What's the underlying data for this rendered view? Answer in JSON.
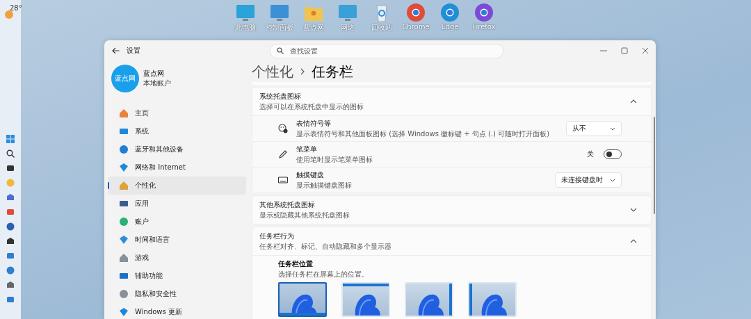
{
  "taskbar": {
    "weather": "28°"
  },
  "desktop_icons": [
    {
      "label": "此电脑"
    },
    {
      "label": "控制面板"
    },
    {
      "label": "蓝点网"
    },
    {
      "label": "网络"
    },
    {
      "label": "回收站"
    },
    {
      "label": "Chrome"
    },
    {
      "label": "Edge"
    },
    {
      "label": "Firefox"
    }
  ],
  "window": {
    "title": "设置",
    "search": {
      "placeholder": "查找设置"
    }
  },
  "profile": {
    "name": "蓝点网",
    "account": "本地账户",
    "avatar_text": "蓝点网"
  },
  "sidebar": {
    "items": [
      {
        "label": "主页",
        "selected": false
      },
      {
        "label": "系统",
        "selected": false
      },
      {
        "label": "蓝牙和其他设备",
        "selected": false
      },
      {
        "label": "网络和 Internet",
        "selected": false
      },
      {
        "label": "个性化",
        "selected": true
      },
      {
        "label": "应用",
        "selected": false
      },
      {
        "label": "账户",
        "selected": false
      },
      {
        "label": "时间和语言",
        "selected": false
      },
      {
        "label": "游戏",
        "selected": false
      },
      {
        "label": "辅助功能",
        "selected": false
      },
      {
        "label": "隐私和安全性",
        "selected": false
      },
      {
        "label": "Windows 更新",
        "selected": false
      }
    ]
  },
  "breadcrumb": {
    "parent": "个性化",
    "current": "任务栏"
  },
  "sections": [
    {
      "title": "系统托盘图标",
      "subtitle": "选择可以在系统托盘中显示的图标",
      "expanded": true,
      "rows": [
        {
          "kind": "dropdown",
          "title": "表情符号等",
          "subtitle": "显示表情符号和其他面板图标 (选择 Windows 徽标键 + 句点 (.) 可随时打开面板)",
          "value": "从不"
        },
        {
          "kind": "toggle",
          "title": "笔菜单",
          "subtitle": "使用笔时显示笔菜单图标",
          "state_label": "关",
          "on": false
        },
        {
          "kind": "dropdown",
          "title": "触摸键盘",
          "subtitle": "显示触摸键盘图标",
          "value": "未连接键盘时"
        }
      ]
    },
    {
      "title": "其他系统托盘图标",
      "subtitle": "显示或隐藏其他系统托盘图标",
      "expanded": false
    },
    {
      "title": "任务栏行为",
      "subtitle": "任务栏对齐、标记、自动隐藏和多个显示器",
      "expanded": true,
      "position": {
        "title": "任务栏位置",
        "subtitle": "选择任务栏在屏幕上的位置。",
        "options": [
          {
            "kind": "bottom",
            "selected": true
          },
          {
            "kind": "top",
            "selected": false
          },
          {
            "kind": "right",
            "selected": false
          },
          {
            "kind": "left",
            "selected": false
          }
        ]
      }
    }
  ]
}
